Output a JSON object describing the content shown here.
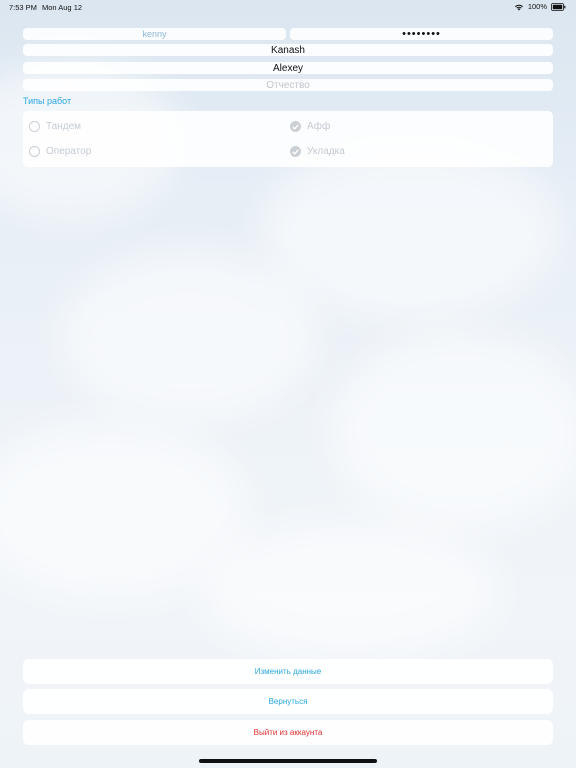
{
  "status_bar": {
    "time": "7:53 PM",
    "date": "Mon Aug 12",
    "battery": "100%"
  },
  "form": {
    "login_value": "kenny",
    "password_value": "••••••••",
    "lastname_value": "Kanash",
    "firstname_value": "Alexey",
    "patronymic_placeholder": "Отчество"
  },
  "work_types": {
    "heading": "Типы работ",
    "options": [
      {
        "label": "Тандем",
        "checked": false
      },
      {
        "label": "Афф",
        "checked": true
      },
      {
        "label": "Оператор",
        "checked": false
      },
      {
        "label": "Укладка",
        "checked": true
      }
    ]
  },
  "actions": {
    "edit_label": "Изменить данные",
    "back_label": "Вернуться",
    "logout_label": "Выйти из аккаунта"
  },
  "colors": {
    "accent": "#2aa6e0",
    "danger": "#e0302e"
  },
  "icons": {
    "wifi": "wifi-icon",
    "battery": "battery-icon",
    "checkmark": "checkmark-icon"
  }
}
